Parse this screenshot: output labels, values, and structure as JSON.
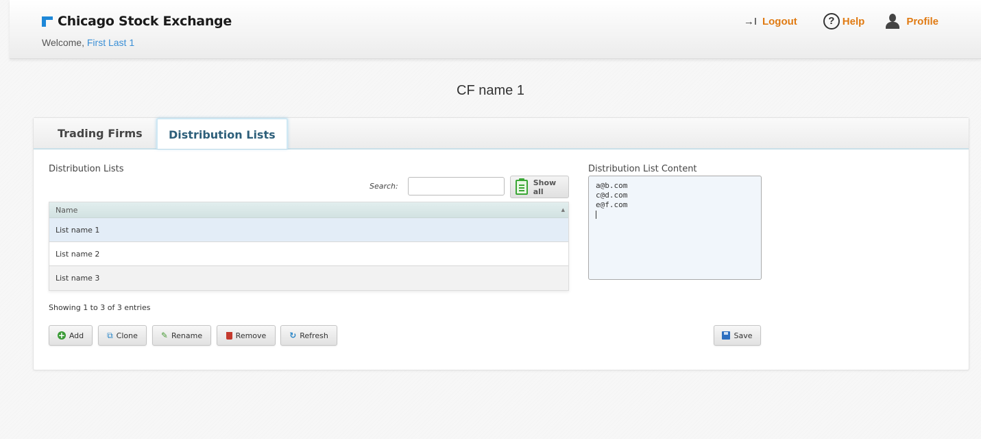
{
  "header": {
    "logo_text": "Chicago Stock Exchange",
    "welcome_prefix": "Welcome, ",
    "user_name": "First Last 1",
    "logout_glyph": "→I",
    "logout_label": "Logout",
    "help_glyph": "?",
    "help_label": "Help",
    "profile_label": "Profile",
    "brand_color": "#1e88d8",
    "link_color": "#e07a12"
  },
  "page": {
    "title": "CF name 1"
  },
  "tabs": [
    {
      "label": "Trading Firms",
      "active": false
    },
    {
      "label": "Distribution Lists",
      "active": true
    }
  ],
  "lists_panel": {
    "heading": "Distribution Lists",
    "search_label": "Search:",
    "search_value": "",
    "show_all_label": "Show all",
    "column_header": "Name",
    "rows": [
      "List name 1",
      "List name 2",
      "List name 3"
    ],
    "selected_row": 0,
    "info": "Showing 1 to 3 of 3 entries"
  },
  "buttons": {
    "add": "Add",
    "clone": "Clone",
    "rename": "Rename",
    "remove": "Remove",
    "refresh": "Refresh",
    "save": "Save"
  },
  "content_panel": {
    "heading": "Distribution List Content",
    "lines": [
      "a@b.com",
      "c@d.com",
      "e@f.com"
    ]
  }
}
